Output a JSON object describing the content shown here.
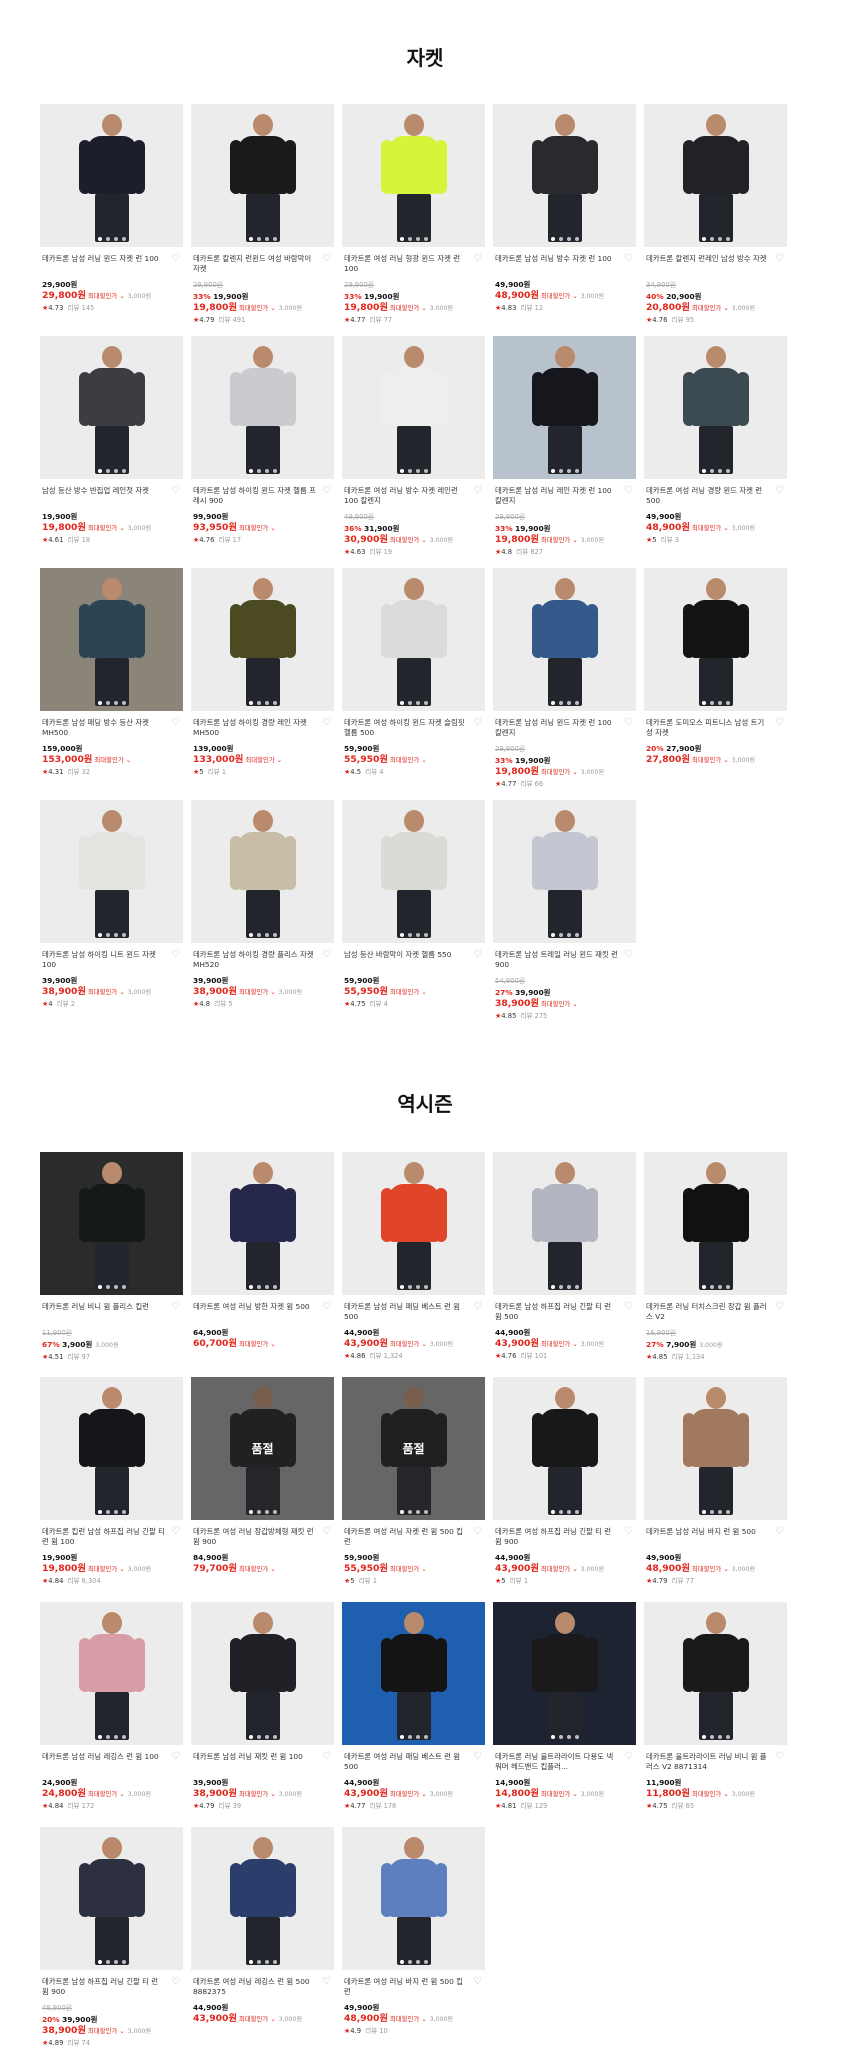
{
  "sections": [
    {
      "title": "자켓",
      "products": [
        {
          "name": "데카트론 남성 러닝 윈드 자켓 런 100",
          "original": "",
          "discount": "",
          "price": "29,900원",
          "sale_price": "29,800원",
          "max_discount_label": "최대할인가",
          "points": "3,000원",
          "rating": "4.73",
          "reviews": "리뷰 145",
          "theme": "light",
          "garment": "#1c1f2b",
          "soldout": false
        },
        {
          "name": "데카트론 칼렌지 런윈드 여성 바람막이 자켓",
          "original": "29,900원",
          "discount": "33%",
          "price": "19,900원",
          "sale_price": "19,800원",
          "max_discount_label": "최대할인가",
          "points": "3,000원",
          "rating": "4.79",
          "reviews": "리뷰 491",
          "theme": "light",
          "garment": "#1a1a1a",
          "soldout": false
        },
        {
          "name": "데카트론 여성 러닝 형광 윈드 자켓 런 100",
          "original": "29,900원",
          "discount": "33%",
          "price": "19,900원",
          "sale_price": "19,800원",
          "max_discount_label": "최대할인가",
          "points": "3,000원",
          "rating": "4.77",
          "reviews": "리뷰 77",
          "theme": "light",
          "garment": "#d4f53a",
          "soldout": false
        },
        {
          "name": "데카트론 남성 러닝 방수 자켓 런 100",
          "original": "",
          "discount": "",
          "price": "49,900원",
          "sale_price": "48,900원",
          "max_discount_label": "최대할인가",
          "points": "3,000원",
          "rating": "4.83",
          "reviews": "리뷰 12",
          "theme": "light",
          "garment": "#2a2a2e",
          "soldout": false
        },
        {
          "name": "데카트론 칼렌지 런레인 남성 방수 자켓",
          "original": "34,900원",
          "discount": "40%",
          "price": "20,900원",
          "sale_price": "20,800원",
          "max_discount_label": "최대할인가",
          "points": "3,000원",
          "rating": "4.76",
          "reviews": "리뷰 95",
          "theme": "light",
          "garment": "#222226",
          "soldout": false
        },
        {
          "name": "남성 등산 방수 반집업 레인첫 자켓",
          "original": "",
          "discount": "",
          "price": "19,900원",
          "sale_price": "19,800원",
          "max_discount_label": "최대할인가",
          "points": "3,000원",
          "rating": "4.61",
          "reviews": "리뷰 18",
          "theme": "light",
          "garment": "#3b3d42",
          "soldout": false
        },
        {
          "name": "데카트론 남성 하이킹 윈드 자켓 헬름 프레시 900",
          "original": "",
          "discount": "",
          "price": "99,900원",
          "sale_price": "93,950원",
          "max_discount_label": "최대할인가",
          "points": "",
          "rating": "4.76",
          "reviews": "리뷰 17",
          "theme": "light",
          "garment": "#c9cbcf",
          "soldout": false
        },
        {
          "name": "데카트론 여성 러닝 방수 자켓 레인런 100 칼렌지",
          "original": "49,900원",
          "discount": "36%",
          "price": "31,900원",
          "sale_price": "30,900원",
          "max_discount_label": "최대할인가",
          "points": "3,000원",
          "rating": "4.63",
          "reviews": "리뷰 19",
          "theme": "light",
          "garment": "#eeeeee",
          "soldout": false
        },
        {
          "name": "데카트론 남성 러닝 레인 자켓 런 100 칼렌지",
          "original": "29,900원",
          "discount": "33%",
          "price": "19,900원",
          "sale_price": "19,800원",
          "max_discount_label": "최대할인가",
          "points": "3,000원",
          "rating": "4.8",
          "reviews": "리뷰 827",
          "theme": "sky",
          "garment": "#15171c",
          "soldout": false
        },
        {
          "name": "데카트론 여성 러닝 경량 윈드 자켓 런 500",
          "original": "",
          "discount": "",
          "price": "49,900원",
          "sale_price": "48,900원",
          "max_discount_label": "최대할인가",
          "points": "3,000원",
          "rating": "5",
          "reviews": "리뷰 3",
          "theme": "light",
          "garment": "#3c4a52",
          "soldout": false
        },
        {
          "name": "데카트론 남성 패딩 방수 등산 자켓 MH500",
          "original": "",
          "discount": "",
          "price": "159,000원",
          "sale_price": "153,000원",
          "max_discount_label": "최대할인가",
          "points": "",
          "rating": "4.31",
          "reviews": "리뷰 32",
          "theme": "rock",
          "garment": "#2c4454",
          "soldout": false
        },
        {
          "name": "데카트론 남성 하이킹 경량 레인 자켓 MH500",
          "original": "",
          "discount": "",
          "price": "139,000원",
          "sale_price": "133,000원",
          "max_discount_label": "최대할인가",
          "points": "",
          "rating": "5",
          "reviews": "리뷰 1",
          "theme": "light",
          "garment": "#4b4a22",
          "soldout": false
        },
        {
          "name": "데카트론 여성 하이킹 윈드 자켓 슬림핏 헬름 500",
          "original": "",
          "discount": "",
          "price": "59,900원",
          "sale_price": "55,950원",
          "max_discount_label": "최대할인가",
          "points": "",
          "rating": "4.5",
          "reviews": "리뷰 4",
          "theme": "light",
          "garment": "#d9dcd8",
          "soldout": false
        },
        {
          "name": "데카트론 남성 러닝 윈드 자켓 런 100 칼렌지",
          "original": "29,900원",
          "discount": "33%",
          "price": "19,900원",
          "sale_price": "19,800원",
          "max_discount_label": "최대할인가",
          "points": "3,000원",
          "rating": "4.77",
          "reviews": "리뷰 66",
          "theme": "light",
          "garment": "#34598a",
          "soldout": false
        },
        {
          "name": "데카트론 도미오스 피트니스 남성 트기성 자켓",
          "original": "",
          "discount": "20%",
          "price": "27,900원",
          "sale_price": "27,800원",
          "max_discount_label": "최대할인가",
          "points": "3,000원",
          "rating": "",
          "reviews": "",
          "theme": "light",
          "garment": "#141414",
          "soldout": false
        },
        {
          "name": "데카트론 남성 하이킹 니트 윈드 자켓 100",
          "original": "",
          "discount": "",
          "price": "39,900원",
          "sale_price": "38,900원",
          "max_discount_label": "최대할인가",
          "points": "3,000원",
          "rating": "4",
          "reviews": "리뷰 2",
          "theme": "light",
          "garment": "#e4e3df",
          "soldout": false
        },
        {
          "name": "데카트론 남성 하이킹 경량 플리스 자켓 MH520",
          "original": "",
          "discount": "",
          "price": "39,900원",
          "sale_price": "38,900원",
          "max_discount_label": "최대할인가",
          "points": "3,000원",
          "rating": "4.8",
          "reviews": "리뷰 5",
          "theme": "light",
          "garment": "#c8bda6",
          "soldout": false
        },
        {
          "name": "남성 등산 바람막이 자켓 헬름 550",
          "original": "",
          "discount": "",
          "price": "59,900원",
          "sale_price": "55,950원",
          "max_discount_label": "최대할인가",
          "points": "",
          "rating": "4.75",
          "reviews": "리뷰 4",
          "theme": "light",
          "garment": "#dcdad4",
          "soldout": false
        },
        {
          "name": "데카트론 남성 트레일 러닝 윈드 재킷 런 900",
          "original": "54,900원",
          "discount": "27%",
          "price": "39,900원",
          "sale_price": "38,900원",
          "max_discount_label": "최대할인가",
          "points": "",
          "rating": "4.85",
          "reviews": "리뷰 275",
          "theme": "light",
          "garment": "#c4c6d2",
          "soldout": false
        }
      ]
    },
    {
      "title": "역시즌",
      "products": [
        {
          "name": "데카트론 러닝 비니 윔 플리스 킵런",
          "original": "11,900원",
          "discount": "67%",
          "price": "3,900원",
          "sale_price": "",
          "max_discount_label": "",
          "points": "3,000원",
          "rating": "4.51",
          "reviews": "리뷰 97",
          "theme": "dark",
          "garment": "#141a17",
          "soldout": false
        },
        {
          "name": "데카트론 여성 러닝 방한 자켓 윔 500",
          "original": "",
          "discount": "",
          "price": "64,900원",
          "sale_price": "60,700원",
          "max_discount_label": "최대할인가",
          "points": "",
          "rating": "",
          "reviews": "",
          "theme": "light",
          "garment": "#25284a",
          "soldout": false
        },
        {
          "name": "데카트론 남성 러닝 패딩 베스트 런 윔 500",
          "original": "",
          "discount": "",
          "price": "44,900원",
          "sale_price": "43,900원",
          "max_discount_label": "최대할인가",
          "points": "3,000원",
          "rating": "4.86",
          "reviews": "리뷰 1,324",
          "theme": "light",
          "garment": "#e0452a",
          "soldout": false
        },
        {
          "name": "데카트론 남성 하프집 러닝 긴팔 티 런 윔 500",
          "original": "",
          "discount": "",
          "price": "44,900원",
          "sale_price": "43,900원",
          "max_discount_label": "최대할인가",
          "points": "3,000원",
          "rating": "4.76",
          "reviews": "리뷰 101",
          "theme": "light",
          "garment": "#b3b6c0",
          "soldout": false
        },
        {
          "name": "데카트론 러닝 터치스크린 장갑 윔 플러스 V2",
          "original": "16,900원",
          "discount": "27%",
          "price": "7,900원",
          "sale_price": "",
          "max_discount_label": "",
          "points": "3,000원",
          "rating": "4.85",
          "reviews": "리뷰 1,134",
          "theme": "light",
          "garment": "#111111",
          "soldout": false
        },
        {
          "name": "데카트론 킵런 남성 하프집 러닝 긴팔 티 런 윔 100",
          "original": "",
          "discount": "",
          "price": "19,900원",
          "sale_price": "19,800원",
          "max_discount_label": "최대할인가",
          "points": "3,000원",
          "rating": "4.84",
          "reviews": "리뷰 8,304",
          "theme": "light",
          "garment": "#15161a",
          "soldout": false
        },
        {
          "name": "데카트론 여성 러닝 장갑방체형 재킷 런 윔 900",
          "original": "",
          "discount": "",
          "price": "84,900원",
          "sale_price": "79,700원",
          "max_discount_label": "최대할인가",
          "points": "",
          "rating": "",
          "reviews": "",
          "theme": "mid",
          "garment": "#1d1d20",
          "soldout": true,
          "soldout_label": "품절"
        },
        {
          "name": "데카트론 여성 러닝 자켓 런 윔 500 킵런",
          "original": "",
          "discount": "",
          "price": "59,900원",
          "sale_price": "55,950원",
          "max_discount_label": "최대할인가",
          "points": "",
          "rating": "5",
          "reviews": "리뷰 1",
          "theme": "mid",
          "garment": "#1a1a1d",
          "soldout": true,
          "soldout_label": "품절"
        },
        {
          "name": "데카트론 여성 하프집 러닝 긴팔 티 런 윔 900",
          "original": "",
          "discount": "",
          "price": "44,900원",
          "sale_price": "43,900원",
          "max_discount_label": "최대할인가",
          "points": "3,000원",
          "rating": "5",
          "reviews": "리뷰 1",
          "theme": "light",
          "garment": "#18181a",
          "soldout": false
        },
        {
          "name": "데카트론 남성 러닝 바지 런 윔 500",
          "original": "",
          "discount": "",
          "price": "49,900원",
          "sale_price": "48,900원",
          "max_discount_label": "최대할인가",
          "points": "3,000원",
          "rating": "4.79",
          "reviews": "리뷰 77",
          "theme": "light",
          "garment": "#a2785e",
          "soldout": false
        },
        {
          "name": "데카트론 남성 러닝 레깅스 런 윔 100",
          "original": "",
          "discount": "",
          "price": "24,900원",
          "sale_price": "24,800원",
          "max_discount_label": "최대할인가",
          "points": "3,000원",
          "rating": "4.84",
          "reviews": "리뷰 172",
          "theme": "light",
          "garment": "#d79ca6",
          "soldout": false
        },
        {
          "name": "데카트론 남성 러닝 재킷 런 윔 100",
          "original": "",
          "discount": "",
          "price": "39,900원",
          "sale_price": "38,900원",
          "max_discount_label": "최대할인가",
          "points": "3,000원",
          "rating": "4.79",
          "reviews": "리뷰 39",
          "theme": "light",
          "garment": "#202126",
          "soldout": false
        },
        {
          "name": "데카트론 여성 러닝 패딩 베스트 런 윔 500",
          "original": "",
          "discount": "",
          "price": "44,900원",
          "sale_price": "43,900원",
          "max_discount_label": "최대할인가",
          "points": "3,000원",
          "rating": "4.77",
          "reviews": "리뷰 178",
          "theme": "blue",
          "garment": "#141414",
          "soldout": false
        },
        {
          "name": "데카트론 러닝 울트라라이트 다용도 넥워머 헤드밴드 킵플러...",
          "original": "",
          "discount": "",
          "price": "14,900원",
          "sale_price": "14,800원",
          "max_discount_label": "최대할인가",
          "points": "3,000원",
          "rating": "4.81",
          "reviews": "리뷰 129",
          "theme": "night",
          "garment": "#1a1a1c",
          "soldout": false
        },
        {
          "name": "데카트론 울트라라이트 러닝 비니 윔 플러스 V2 8871314",
          "original": "",
          "discount": "",
          "price": "11,900원",
          "sale_price": "11,800원",
          "max_discount_label": "최대할인가",
          "points": "3,000원",
          "rating": "4.75",
          "reviews": "리뷰 65",
          "theme": "light",
          "garment": "#1a1a1a",
          "soldout": false
        },
        {
          "name": "데카트론 남성 하프집 러닝 긴팔 티 런 윔 900",
          "original": "49,900원",
          "discount": "20%",
          "price": "39,900원",
          "sale_price": "38,900원",
          "max_discount_label": "최대할인가",
          "points": "3,000원",
          "rating": "4.89",
          "reviews": "리뷰 74",
          "theme": "light",
          "garment": "#2c3040",
          "soldout": false
        },
        {
          "name": "데카트론 여성 러닝 레깅스 런 윔 500 8882375",
          "original": "",
          "discount": "",
          "price": "44,900원",
          "sale_price": "43,900원",
          "max_discount_label": "최대할인가",
          "points": "3,000원",
          "rating": "",
          "reviews": "",
          "theme": "light",
          "garment": "#2b3d6a",
          "soldout": false
        },
        {
          "name": "데카트론 여성 러닝 바지 런 윔 500 킵런",
          "original": "",
          "discount": "",
          "price": "49,900원",
          "sale_price": "48,900원",
          "max_discount_label": "최대할인가",
          "points": "3,000원",
          "rating": "4.9",
          "reviews": "리뷰 10",
          "theme": "light",
          "garment": "#5d7fc0",
          "soldout": false
        }
      ]
    }
  ],
  "icons": {
    "heart": "heart-icon",
    "star": "star-icon",
    "chevron": "chevron-down-icon",
    "points": "points-icon"
  },
  "colors": {
    "sale": "#e1251b",
    "muted": "#999999",
    "text": "#111111"
  }
}
